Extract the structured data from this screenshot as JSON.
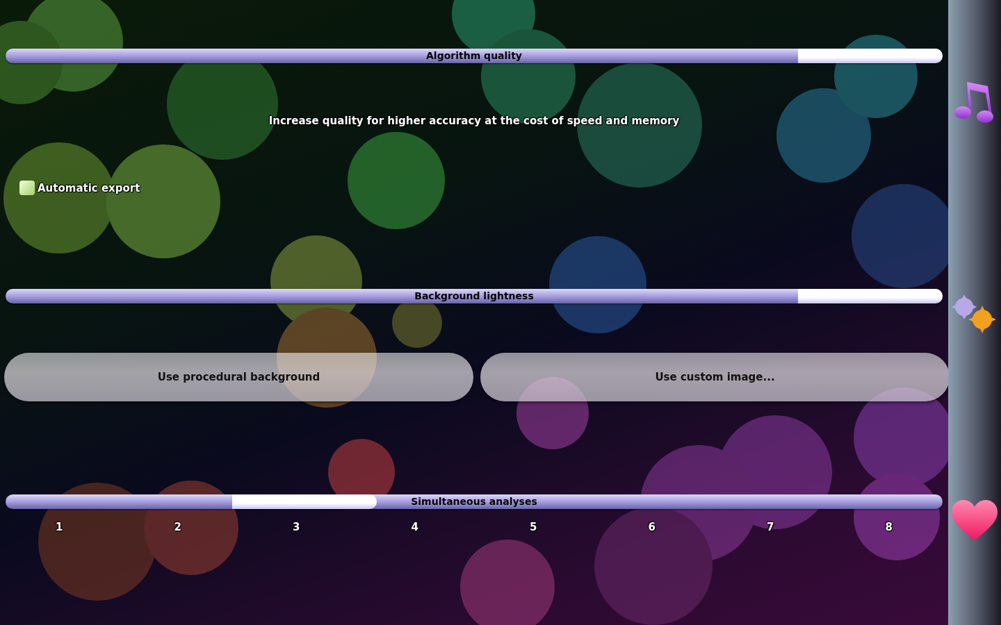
{
  "items": [
    {
      "kind": "slider",
      "label": "Algorithm quality",
      "level": 1
    },
    {
      "kind": "caption",
      "text": "Increase quality for higher accuracy at the cost of speed and memory"
    },
    {
      "kind": "checkbox",
      "label": "Automatic export",
      "checked": false
    },
    {
      "kind": "slider",
      "label": "Background lightness",
      "level": 1
    },
    {
      "kind": "buttons",
      "buttons": [
        "Use procedural background",
        "Use custom image..."
      ]
    },
    {
      "kind": "slider",
      "label": "Simultaneous analyses",
      "level": 0.2857,
      "ticks": [
        "1",
        "2",
        "3",
        "4",
        "5",
        "6",
        "7",
        "8"
      ]
    }
  ],
  "sidebar": {
    "items": [
      {
        "kind": "music"
      },
      {
        "kind": "gears"
      },
      {
        "kind": "heart"
      }
    ]
  }
}
